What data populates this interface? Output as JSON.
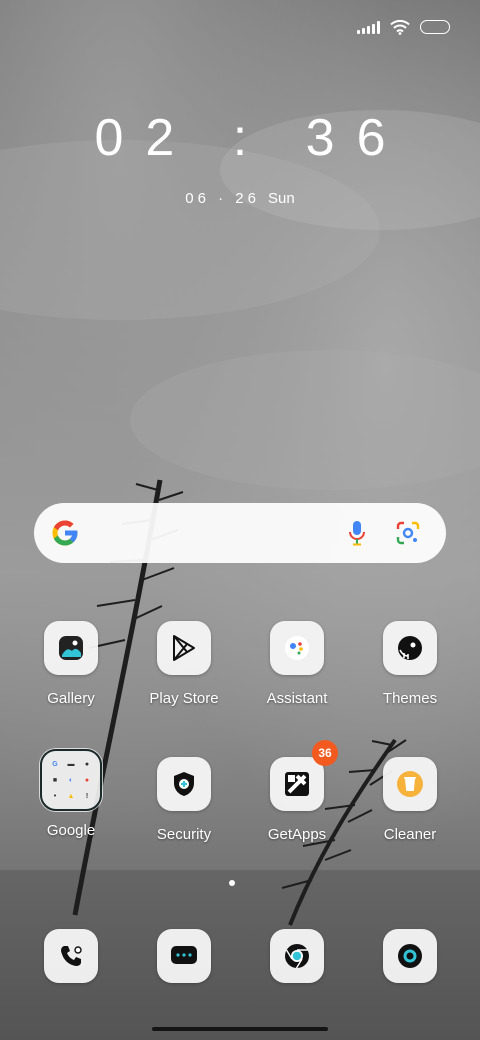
{
  "clock": {
    "time": "02 : 36",
    "date": "06 · 26",
    "day": "Sun"
  },
  "status_icons": [
    "signal-icon",
    "wifi-icon",
    "battery-icon"
  ],
  "search_widget": {
    "icons": [
      "google-g-icon",
      "microphone-icon",
      "google-lens-icon"
    ]
  },
  "apps": [
    {
      "label": "Gallery",
      "icon": "gallery-icon"
    },
    {
      "label": "Play Store",
      "icon": "play-store-icon"
    },
    {
      "label": "Assistant",
      "icon": "assistant-icon"
    },
    {
      "label": "Themes",
      "icon": "themes-icon"
    },
    {
      "label": "Google",
      "icon": "folder-icon"
    },
    {
      "label": "Security",
      "icon": "security-shield-icon"
    },
    {
      "label": "GetApps",
      "icon": "getapps-icon",
      "badge": "36"
    },
    {
      "label": "Cleaner",
      "icon": "cleaner-trash-icon"
    }
  ],
  "dock": [
    "phone-icon",
    "messages-icon",
    "chrome-icon",
    "camera-icon"
  ],
  "colors": {
    "badge": "#f35a1f",
    "google_blue": "#4285F4",
    "google_red": "#EA4335",
    "google_yellow": "#FBBC05",
    "google_green": "#34A853",
    "gallery_teal": "#33c3d6",
    "cleaner_yellow": "#f7b23b"
  }
}
